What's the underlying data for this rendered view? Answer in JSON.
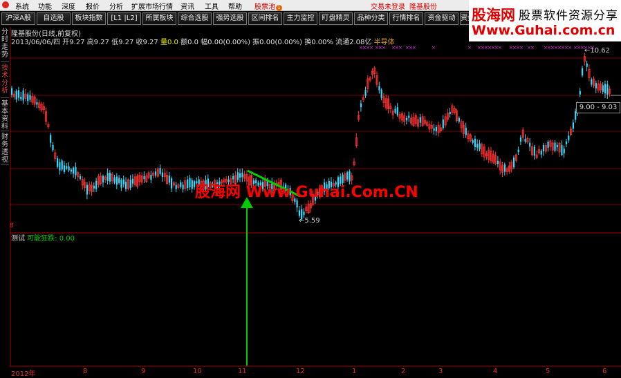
{
  "menu": {
    "items": [
      "系统",
      "功能",
      "深度",
      "报价",
      "分析",
      "扩展市场行情",
      "资讯",
      "工具",
      "帮助"
    ],
    "stock_pool": "股票池",
    "stock_pool_badge": "1",
    "trade_status": "交易未登录",
    "stock_title": "隆基股份"
  },
  "toolbar": [
    "沪深A股",
    "自选股",
    "板块指数",
    "[L1 |L2]",
    "所属板块",
    "综合选股",
    "强势选股",
    "区间排名",
    "主力监控",
    "盯盘精灵",
    "品种分类",
    "行情排名",
    "资金驱动",
    "资金"
  ],
  "side_tabs": [
    "分时走势",
    "技术分析",
    "基本资料",
    "财务透视"
  ],
  "banner": {
    "line1": "股海网",
    "line2": "股票软件资源分享",
    "line3": "Www.Guhai.com.cn"
  },
  "info": {
    "title": "隆基股份(日线,前复权)",
    "ohlc": "2013/06/06/四 开9.27 高9.27 低9.27 收9.27",
    "volume": "量0.0",
    "rest": "额0.0 幅0.00(0.00%) 振0.00(0.00%) 换0.00% 流通2.08亿",
    "sector": "半导体"
  },
  "watermark": "股海网 Www.Guhai.Com.CN",
  "labels": {
    "high": "10.62",
    "low": "5.59",
    "range": "9.00 - 9.03",
    "left_mark": "8"
  },
  "indicator": {
    "name": "测试",
    "signal_label": "可能狂跌:",
    "signal_value": "0.00"
  },
  "x_axis": [
    "2012年",
    "8",
    "9",
    "10",
    "11",
    "12",
    "1",
    "2",
    "3",
    "4",
    "5",
    "6"
  ],
  "colors": {
    "up": "#ff3030",
    "down": "#33ddff",
    "grid": "#7a0000",
    "signal": "#00d000",
    "marker": "#ff33ff"
  }
}
